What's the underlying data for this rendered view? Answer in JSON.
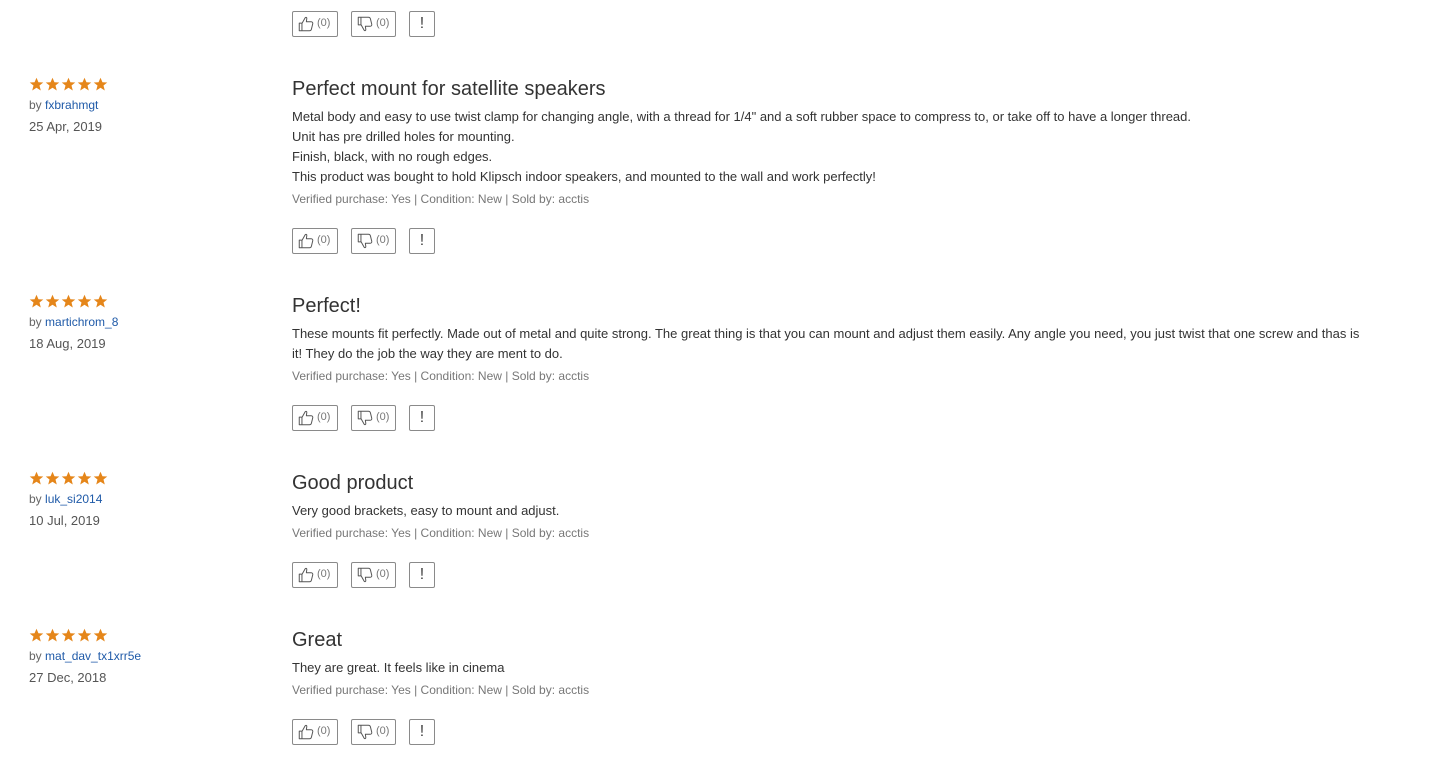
{
  "top_actions": {
    "like_count": "(0)",
    "dislike_count": "(0)",
    "report_label": "!"
  },
  "by_prefix": "by",
  "colors": {
    "star": "#e5861a",
    "link": "#1f5aa8",
    "border": "#8a8a8a"
  },
  "reviews": [
    {
      "rating": 5,
      "author": "fxbrahmgt",
      "date": "25 Apr, 2019",
      "title": "Perfect mount for satellite speakers",
      "lines": [
        "Metal body and easy to use twist clamp for changing angle,  with a thread  for 1/4\" and a soft rubber space to compress to, or take off to have a longer thread.",
        "Unit has pre drilled holes for mounting.",
        "Finish, black, with no rough edges.",
        "This product was bought to hold Klipsch indoor speakers, and mounted to the wall and work perfectly!"
      ],
      "verified": "Verified purchase: Yes | Condition: New | Sold by: acctis",
      "like_count": "(0)",
      "dislike_count": "(0)",
      "report_label": "!"
    },
    {
      "rating": 5,
      "author": "martichrom_8",
      "date": "18 Aug, 2019",
      "title": "Perfect!",
      "lines": [
        "These mounts fit perfectly. Made out of metal and quite strong. The great thing is that you can mount and adjust them easily. Any angle you need, you just twist that one screw and thas is it! They do the job the way they are ment to do."
      ],
      "verified": "Verified purchase: Yes | Condition: New | Sold by: acctis",
      "like_count": "(0)",
      "dislike_count": "(0)",
      "report_label": "!"
    },
    {
      "rating": 5,
      "author": "luk_si2014",
      "date": "10 Jul, 2019",
      "title": "Good product",
      "lines": [
        "Very good brackets, easy to mount and adjust."
      ],
      "verified": "Verified purchase: Yes | Condition: New | Sold by: acctis",
      "like_count": "(0)",
      "dislike_count": "(0)",
      "report_label": "!"
    },
    {
      "rating": 5,
      "author": "mat_dav_tx1xrr5e",
      "date": "27 Dec, 2018",
      "title": "Great",
      "lines": [
        "They are great. It feels like in cinema"
      ],
      "verified": "Verified purchase: Yes | Condition: New | Sold by: acctis",
      "like_count": "(0)",
      "dislike_count": "(0)",
      "report_label": "!"
    }
  ]
}
